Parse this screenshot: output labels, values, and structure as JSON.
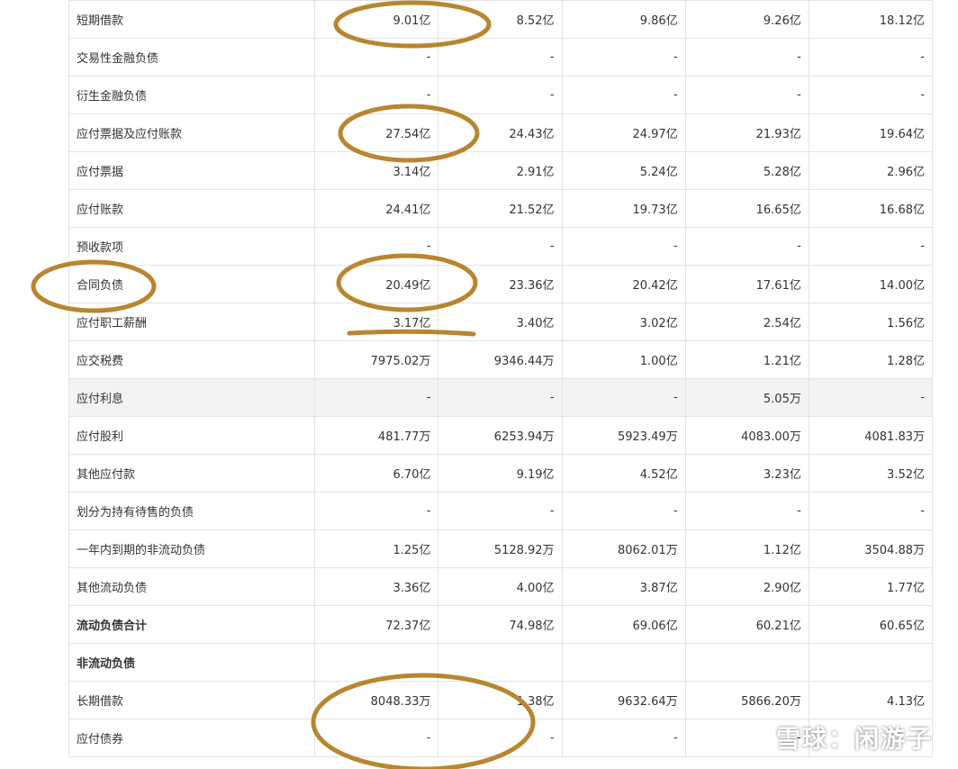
{
  "rows": [
    {
      "label": "短期借款",
      "values": [
        "9.01亿",
        "8.52亿",
        "9.86亿",
        "9.26亿",
        "18.12亿"
      ]
    },
    {
      "label": "交易性金融负债",
      "values": [
        "-",
        "-",
        "-",
        "-",
        "-"
      ]
    },
    {
      "label": "衍生金融负债",
      "values": [
        "-",
        "-",
        "-",
        "-",
        "-"
      ]
    },
    {
      "label": "应付票据及应付账款",
      "values": [
        "27.54亿",
        "24.43亿",
        "24.97亿",
        "21.93亿",
        "19.64亿"
      ]
    },
    {
      "label": "应付票据",
      "values": [
        "3.14亿",
        "2.91亿",
        "5.24亿",
        "5.28亿",
        "2.96亿"
      ]
    },
    {
      "label": "应付账款",
      "values": [
        "24.41亿",
        "21.52亿",
        "19.73亿",
        "16.65亿",
        "16.68亿"
      ]
    },
    {
      "label": "预收款项",
      "values": [
        "-",
        "-",
        "-",
        "-",
        "-"
      ]
    },
    {
      "label": "合同负债",
      "values": [
        "20.49亿",
        "23.36亿",
        "20.42亿",
        "17.61亿",
        "14.00亿"
      ]
    },
    {
      "label": "应付职工薪酬",
      "values": [
        "3.17亿",
        "3.40亿",
        "3.02亿",
        "2.54亿",
        "1.56亿"
      ]
    },
    {
      "label": "应交税费",
      "values": [
        "7975.02万",
        "9346.44万",
        "1.00亿",
        "1.21亿",
        "1.28亿"
      ]
    },
    {
      "label": "应付利息",
      "values": [
        "-",
        "-",
        "-",
        "5.05万",
        "-"
      ]
    },
    {
      "label": "应付股利",
      "values": [
        "481.77万",
        "6253.94万",
        "5923.49万",
        "4083.00万",
        "4081.83万"
      ]
    },
    {
      "label": "其他应付款",
      "values": [
        "6.70亿",
        "9.19亿",
        "4.52亿",
        "3.23亿",
        "3.52亿"
      ]
    },
    {
      "label": "划分为持有待售的负债",
      "values": [
        "-",
        "-",
        "-",
        "-",
        "-"
      ]
    },
    {
      "label": "一年内到期的非流动负债",
      "values": [
        "1.25亿",
        "5128.92万",
        "8062.01万",
        "1.12亿",
        "3504.88万"
      ]
    },
    {
      "label": "其他流动负债",
      "values": [
        "3.36亿",
        "4.00亿",
        "3.87亿",
        "2.90亿",
        "1.77亿"
      ]
    },
    {
      "label": "流动负债合计",
      "values": [
        "72.37亿",
        "74.98亿",
        "69.06亿",
        "60.21亿",
        "60.65亿"
      ]
    },
    {
      "label": "非流动负债",
      "values": [
        "",
        "",
        "",
        "",
        ""
      ]
    },
    {
      "label": "长期借款",
      "values": [
        "8048.33万",
        "1.38亿",
        "9632.64万",
        "5866.20万",
        "4.13亿"
      ]
    },
    {
      "label": "应付债券",
      "values": [
        "-",
        "-",
        "-",
        "-",
        "-"
      ]
    }
  ],
  "watermark": {
    "text": "雪球：闲游子",
    "icon": "xueqiu-logo-icon"
  },
  "colors": {
    "annotation": "#b8862e",
    "border": "#e3e3e3",
    "text": "#333333",
    "shade": "#f3f3f3"
  }
}
